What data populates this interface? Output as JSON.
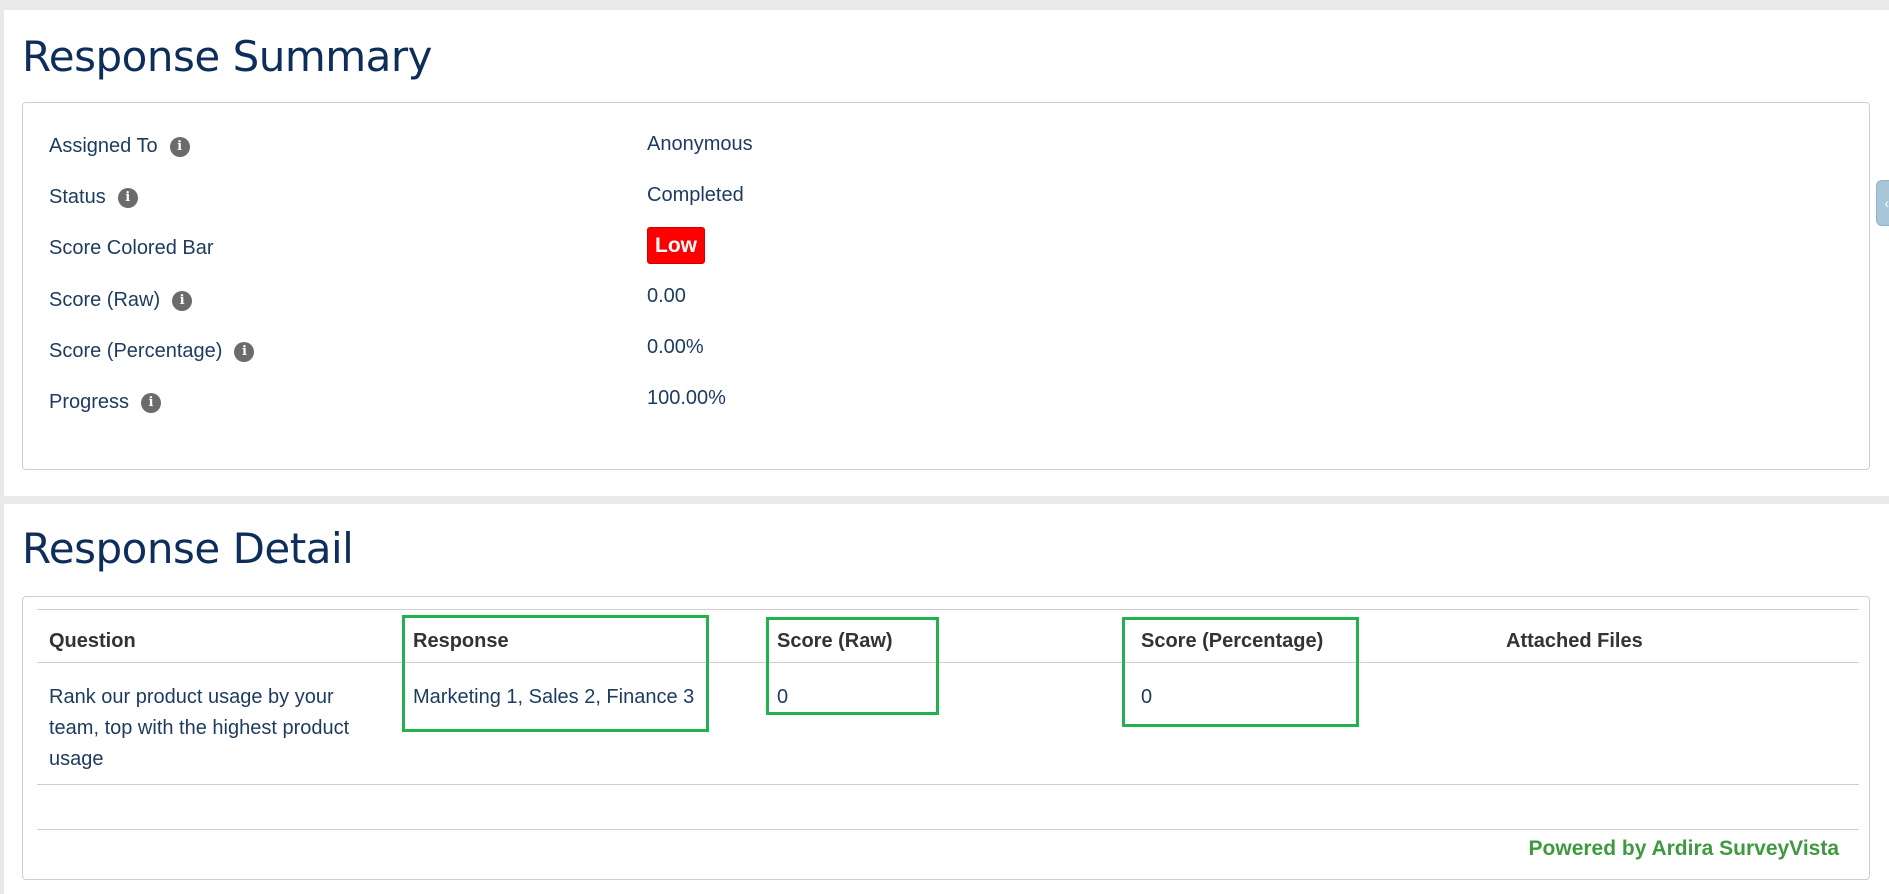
{
  "summary": {
    "title": "Response Summary",
    "fields": [
      {
        "label": "Assigned To",
        "value": "Anonymous",
        "has_info": true
      },
      {
        "label": "Status",
        "value": "Completed",
        "has_info": true
      },
      {
        "label": "Score Colored Bar",
        "value": "Low",
        "has_info": false,
        "badge_color": "#ff0000"
      },
      {
        "label": "Score (Raw)",
        "value": "0.00",
        "has_info": true
      },
      {
        "label": "Score (Percentage)",
        "value": "0.00%",
        "has_info": true
      },
      {
        "label": "Progress",
        "value": "100.00%",
        "has_info": true
      }
    ]
  },
  "detail": {
    "title": "Response Detail",
    "columns": [
      "Question",
      "Response",
      "Score (Raw)",
      "Score (Percentage)",
      "Attached Files"
    ],
    "rows": [
      {
        "question": "Rank our product usage by your team, top with the highest product usage",
        "response": "Marketing 1, Sales 2, Finance 3",
        "score_raw": "0",
        "score_percentage": "0",
        "attached_files": ""
      }
    ],
    "footer": "Powered by Ardira SurveyVista"
  },
  "icons": {
    "info": "info-icon",
    "side_tab": "chevron-left-icon"
  },
  "colors": {
    "title": "#0d2d5a",
    "text": "#1d3a5f",
    "badge_low": "#ff0000",
    "highlight": "#22b14c",
    "powered": "#3f9a3f"
  }
}
